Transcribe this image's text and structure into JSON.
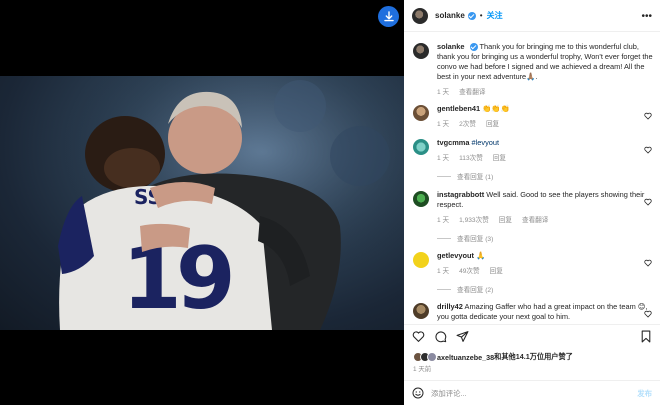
{
  "post": {
    "username": "solanke",
    "follow_label": "关注",
    "dot": "•",
    "more": "•••"
  },
  "comments": [
    {
      "username": "solanke",
      "text": "Thank you for bringing me to this wonderful club, thank you for bringing us a wonderful trophy, Won't ever forget the convo we had before I signed and we achieved a dream! All the best in your next adventure🙏🏽.",
      "time": "1 天",
      "translate": "查看翻译"
    },
    {
      "username": "gentleben41",
      "text": "👏👏👏",
      "time": "1 天",
      "likes": "2次赞",
      "reply": "回复"
    },
    {
      "username": "tvgcmma",
      "text": "#levyout",
      "time": "1 天",
      "likes": "113次赞",
      "reply": "回复",
      "view_replies": "查看回复 (1)"
    },
    {
      "username": "instagrabbott",
      "text": "Well said. Good to see the players showing their respect.",
      "time": "1 天",
      "likes": "1,933次赞",
      "reply": "回复",
      "translate": "查看翻译",
      "view_replies": "查看回复 (3)"
    },
    {
      "username": "getlevyout",
      "text": "🙏",
      "time": "1 天",
      "likes": "49次赞",
      "reply": "回复",
      "view_replies": "查看回复 (2)"
    },
    {
      "username": "drilly42",
      "text": "Amazing Gaffer who had a great impact on the team 😊, you gotta dedicate your next goal to him.",
      "time": "",
      "likes": "",
      "reply": ""
    }
  ],
  "likes": {
    "liker": "axeltuanzebe_38",
    "suffix": "和其他14.1万位用户赞了"
  },
  "posted": "1 天前",
  "add_comment": {
    "placeholder": "添加评论...",
    "post_label": "发布"
  },
  "colors": {
    "accent": "#0095f6",
    "verified": "#3897f0",
    "download": "#1f6fde",
    "hashtag": "#00376b"
  }
}
